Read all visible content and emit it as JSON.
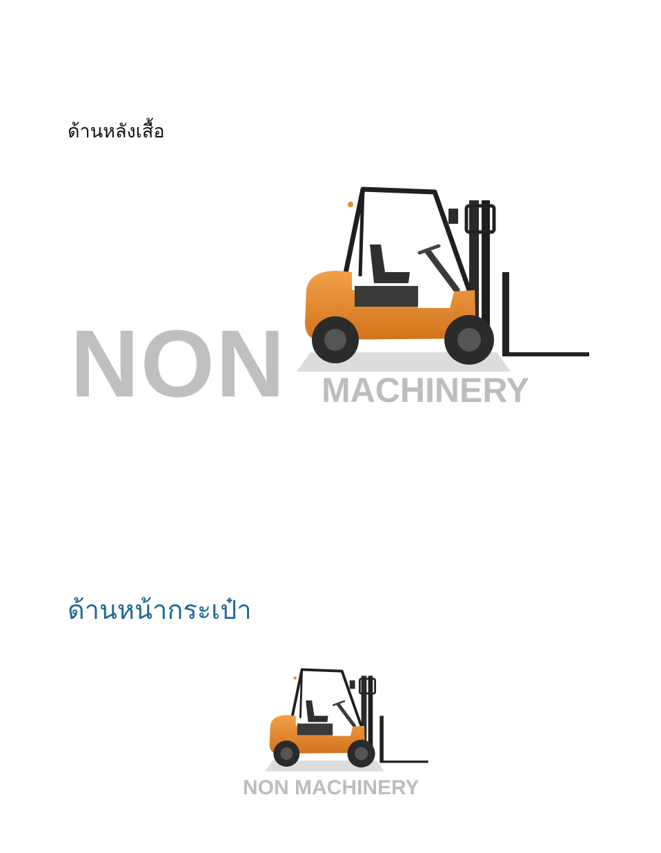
{
  "sections": {
    "back": {
      "heading": "ด้านหลังเสื้อ",
      "watermark_line1": "NON",
      "watermark_line2": "MACHINERY"
    },
    "front": {
      "heading": "ด้านหน้ากระเป๋า",
      "watermark": "NON MACHINERY"
    }
  },
  "colors": {
    "heading_back": "#111111",
    "heading_front": "#1f6a94",
    "watermark": "#bdbdbd",
    "forklift_body": "#e8892a"
  },
  "icons": [
    "forklift-icon"
  ]
}
